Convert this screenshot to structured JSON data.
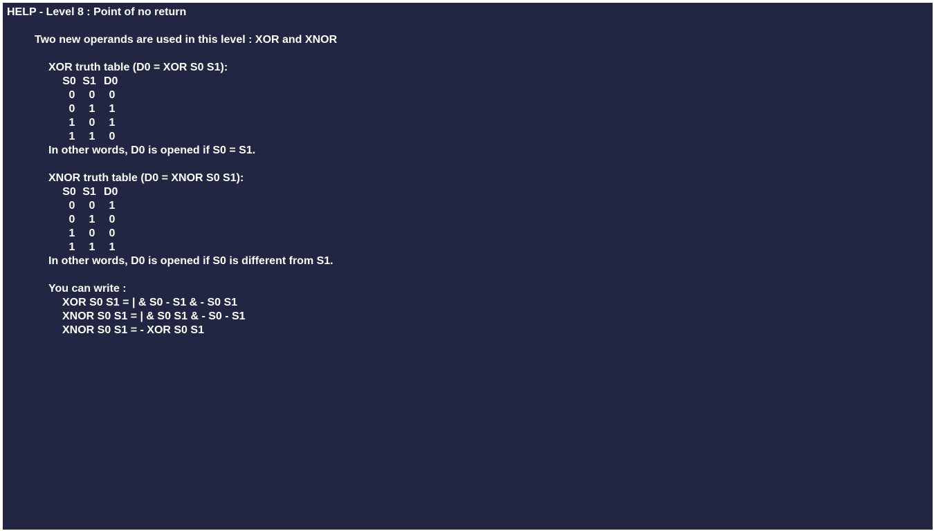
{
  "title": "HELP - Level 8 : Point of no return",
  "intro": "Two new operands are used in this level : XOR and XNOR",
  "xor": {
    "heading": "XOR truth table (D0 = XOR S0 S1):",
    "columns": [
      "S0",
      "S1",
      "D0"
    ],
    "rows": [
      [
        "0",
        "0",
        "0"
      ],
      [
        "0",
        "1",
        "1"
      ],
      [
        "1",
        "0",
        "1"
      ],
      [
        "1",
        "1",
        "0"
      ]
    ],
    "note": "In other words, D0 is opened if S0 = S1."
  },
  "xnor": {
    "heading": "XNOR truth table (D0 = XNOR S0 S1):",
    "columns": [
      "S0",
      "S1",
      "D0"
    ],
    "rows": [
      [
        "0",
        "0",
        "1"
      ],
      [
        "0",
        "1",
        "0"
      ],
      [
        "1",
        "0",
        "0"
      ],
      [
        "1",
        "1",
        "1"
      ]
    ],
    "note": "In other words, D0 is opened if S0 is different from S1."
  },
  "write": {
    "heading": "You can write :",
    "lines": [
      "XOR S0 S1 = | & S0 - S1 & - S0 S1",
      "XNOR S0 S1 = | & S0 S1 & - S0 - S1",
      "XNOR S0 S1 = - XOR S0 S1"
    ]
  }
}
